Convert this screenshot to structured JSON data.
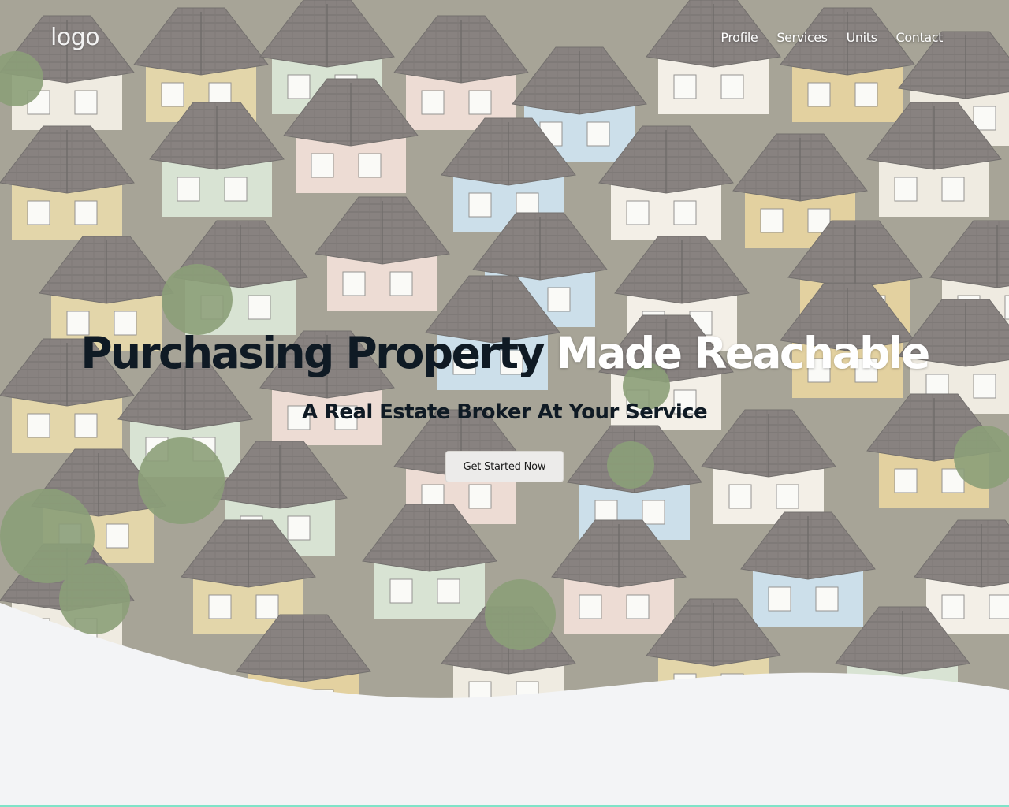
{
  "nav": {
    "logo": "logo",
    "links": [
      "Profile",
      "Services",
      "Units",
      "Contact"
    ]
  },
  "hero": {
    "headline_dark": "Purchasing Property",
    "headline_light": "Made Reachable",
    "subheadline": "A Real Estate Broker At Your Service",
    "cta_label": "Get Started Now"
  },
  "colors": {
    "page_background": "#f3f4f6",
    "headline_dark": "#0f1a24",
    "headline_light": "#ffffff",
    "bottom_accent": "#7fe3c8"
  }
}
